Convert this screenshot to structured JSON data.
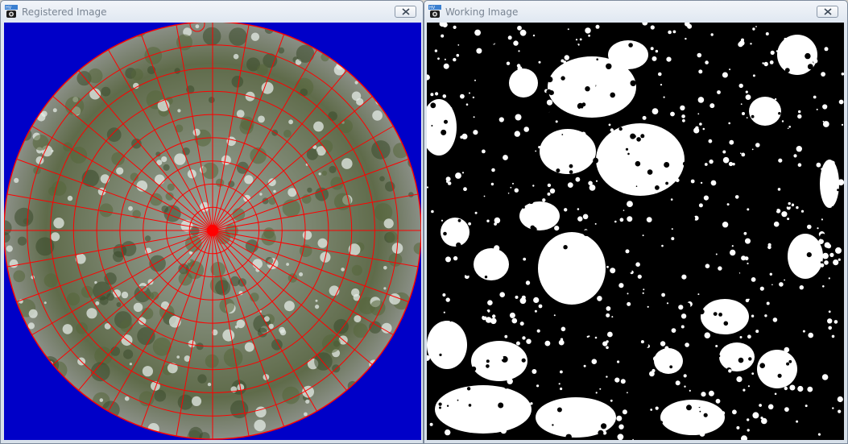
{
  "windows": {
    "registered": {
      "title": "Registered Image",
      "icon": "hemiview-app-icon",
      "close_label": "close",
      "background_color": "#0000c8",
      "grid_color": "#ff0000",
      "grid": {
        "rings": 9,
        "radial_lines": 36
      }
    },
    "working": {
      "title": "Working Image",
      "icon": "hemiview-app-icon",
      "close_label": "close",
      "sky_color": "#ffffff",
      "canopy_color": "#000000"
    }
  }
}
